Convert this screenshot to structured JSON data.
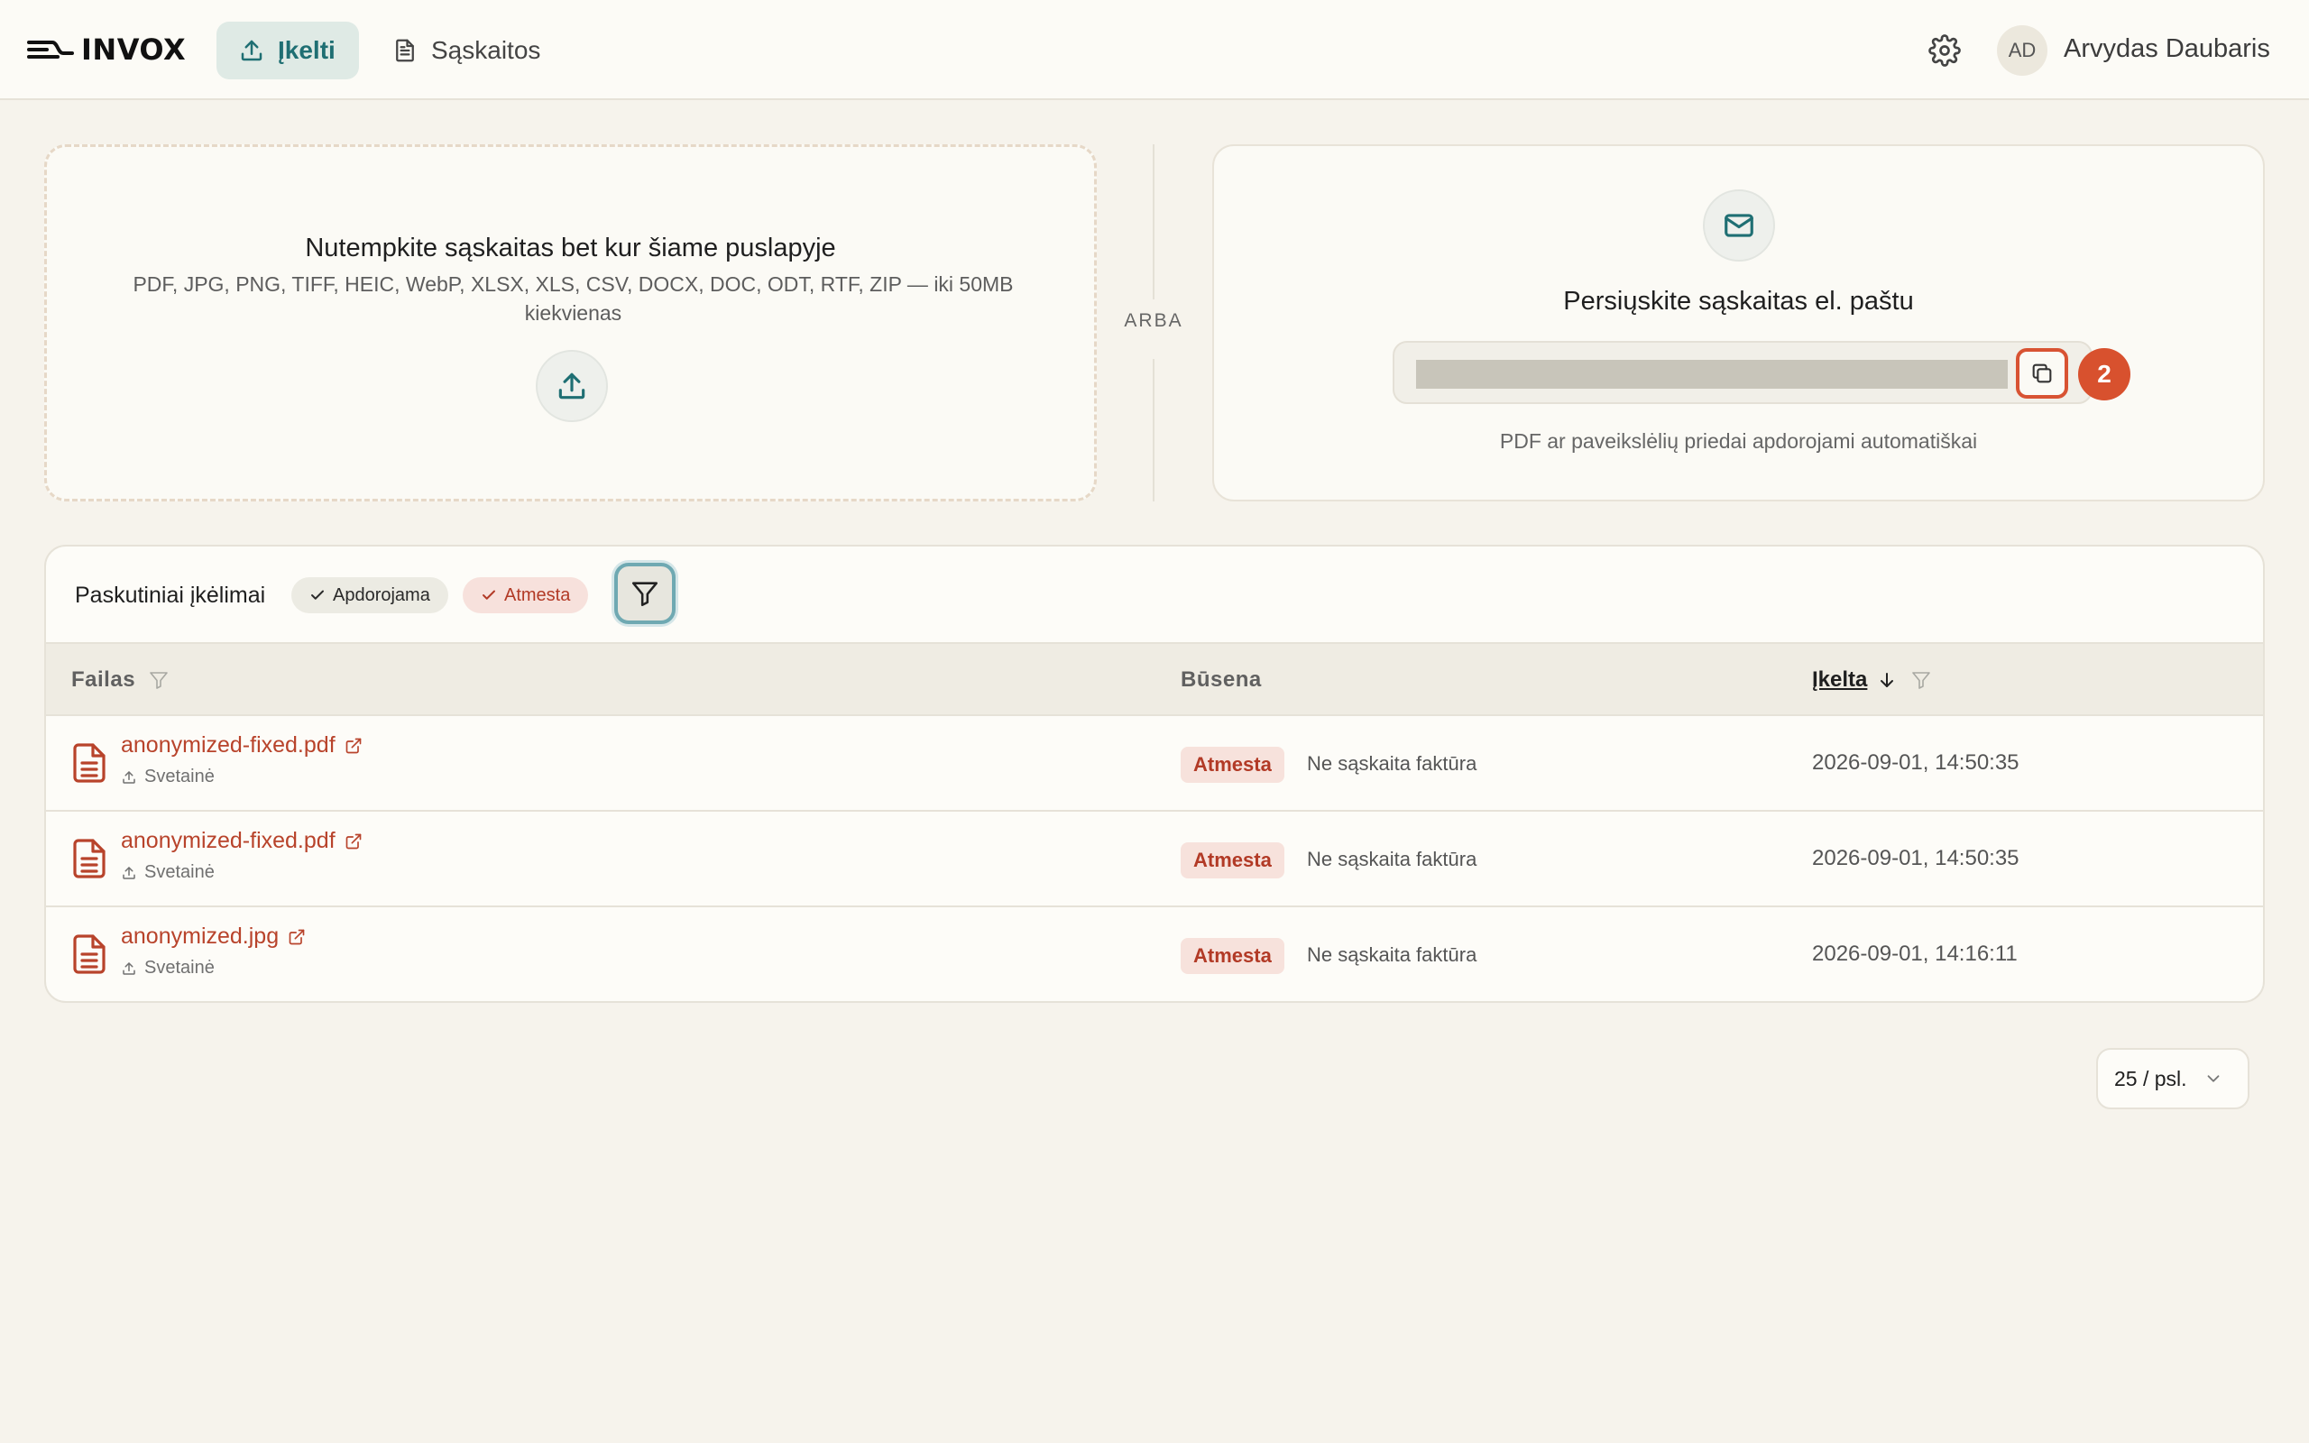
{
  "app": {
    "name": "INVOX"
  },
  "nav": {
    "upload_label": "Įkelti",
    "invoices_label": "Sąskaitos"
  },
  "user": {
    "initials": "AD",
    "name": "Arvydas Daubaris"
  },
  "upload_zone": {
    "title": "Nutempkite sąskaitas bet kur šiame puslapyje",
    "formats": "PDF, JPG, PNG, TIFF, HEIC, WebP, XLSX, XLS, CSV, DOCX, DOC, ODT, RTF, ZIP — iki 50MB kiekvienas"
  },
  "separator_label": "ARBA",
  "email_card": {
    "title": "Persiųskite sąskaitas el. paštu",
    "note": "PDF ar paveikslėlių priedai apdorojami automatiškai",
    "marker": "2"
  },
  "recent": {
    "title": "Paskutiniai įkėlimai",
    "chips": [
      "Apdorojama",
      "Atmesta"
    ],
    "columns": {
      "file": "Failas",
      "status": "Būsena",
      "uploaded": "Įkelta"
    },
    "rows": [
      {
        "file": "anonymized-fixed.pdf",
        "source": "Svetainė",
        "status": "Atmesta",
        "reason": "Ne sąskaita faktūra",
        "date": "2026-09-01, 14:50:35"
      },
      {
        "file": "anonymized-fixed.pdf",
        "source": "Svetainė",
        "status": "Atmesta",
        "reason": "Ne sąskaita faktūra",
        "date": "2026-09-01, 14:50:35"
      },
      {
        "file": "anonymized.jpg",
        "source": "Svetainė",
        "status": "Atmesta",
        "reason": "Ne sąskaita faktūra",
        "date": "2026-09-01, 14:16:11"
      }
    ]
  },
  "pagination": {
    "page_size": "25 / psl."
  },
  "colors": {
    "accent": "#1f6f73",
    "danger": "#b8432b",
    "marker": "#d8512e",
    "background": "#f6f3ec"
  }
}
